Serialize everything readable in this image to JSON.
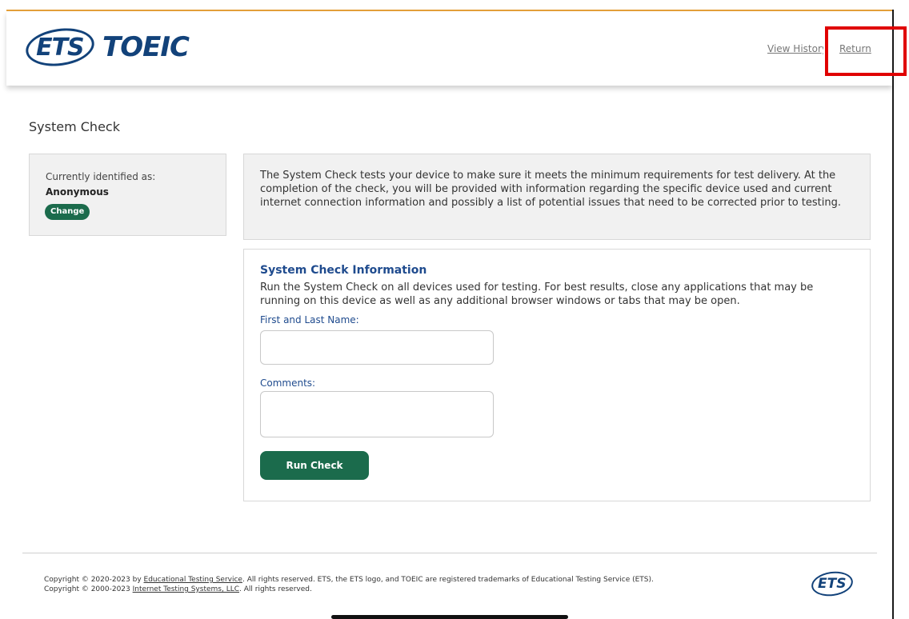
{
  "header": {
    "logo_ets": "ETS",
    "logo_toeic": "TOEIC",
    "view_history": "View History",
    "return": "Return"
  },
  "page": {
    "title": "System Check"
  },
  "identity": {
    "label": "Currently identified as:",
    "name": "Anonymous",
    "change": "Change"
  },
  "intro": {
    "text": "The System Check tests your device to make sure it meets the minimum requirements for test delivery. At the completion of the check, you will be provided with information regarding the specific device used and current internet connection information and possibly a list of potential issues that need to be corrected prior to testing."
  },
  "form": {
    "heading": "System Check Information",
    "description": "Run the System Check on all devices used for testing. For best results, close any applications that may be running on this device as well as any additional browser windows or tabs that may be open.",
    "name_label": "First and Last Name:",
    "name_value": "",
    "comments_label": "Comments:",
    "comments_value": "",
    "run_button": "Run Check"
  },
  "footer": {
    "line1_prefix": "Copyright © 2020-2023 by ",
    "line1_link": "Educational Testing Service",
    "line1_suffix": ". All rights reserved. ETS, the ETS logo, and TOEIC are registered trademarks of Educational Testing Service (ETS).",
    "line2_prefix": "Copyright © 2000-2023 ",
    "line2_link": "Internet Testing Systems, LLC",
    "line2_suffix": ". All rights reserved.",
    "logo_text": "ETS"
  },
  "colors": {
    "brand_blue": "#12427a",
    "button_green": "#1b6b4c",
    "annotation_red": "#e00000",
    "accent_orange": "#e6a13a"
  }
}
